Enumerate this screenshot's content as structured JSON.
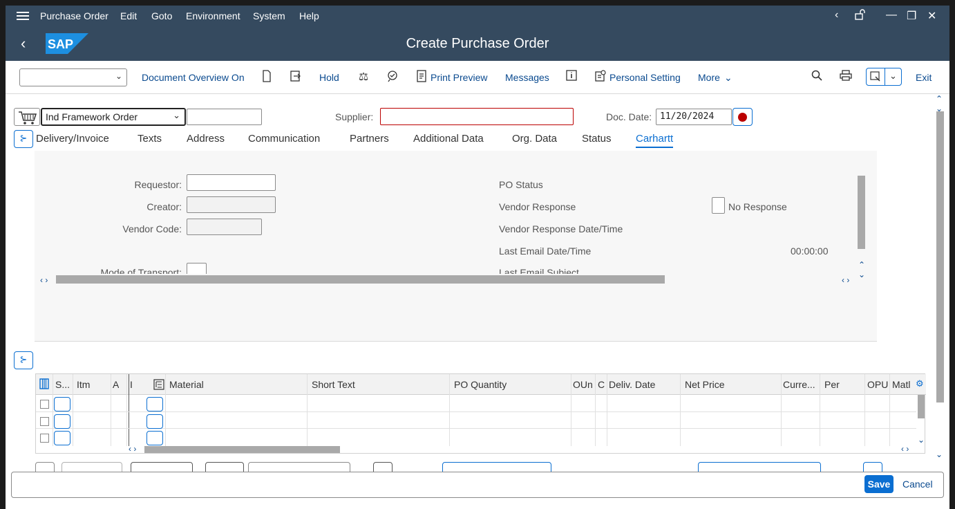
{
  "menu": {
    "items": [
      "Purchase Order",
      "Edit",
      "Goto",
      "Environment",
      "System",
      "Help"
    ]
  },
  "title": {
    "app_title": "Create Purchase Order",
    "logo_text": "SAP"
  },
  "toolbar": {
    "document_overview": "Document Overview On",
    "hold": "Hold",
    "print_preview": "Print Preview",
    "messages": "Messages",
    "personal_setting": "Personal Setting",
    "more": "More",
    "exit": "Exit"
  },
  "header": {
    "order_type": "Ind Framework Order",
    "supplier_label": "Supplier:",
    "supplier_value": "",
    "doc_date_label": "Doc. Date:",
    "doc_date_value": "11/20/2024"
  },
  "tabs": [
    "Delivery/Invoice",
    "Texts",
    "Address",
    "Communication",
    "Partners",
    "Additional Data",
    "Org. Data",
    "Status",
    "Carhartt"
  ],
  "active_tab": "Carhartt",
  "carhartt": {
    "requestor_label": "Requestor:",
    "creator_label": "Creator:",
    "vendor_code_label": "Vendor Code:",
    "mode_transport_label": "Mode of Transport:",
    "po_status_label": "PO Status",
    "vendor_response_label": "Vendor Response",
    "no_response_label": "No Response",
    "vendor_response_dt_label": "Vendor Response Date/Time",
    "last_email_dt_label": "Last Email Date/Time",
    "last_email_dt_value": "00:00:00",
    "last_email_subject_label": "Last Email Subject"
  },
  "grid": {
    "columns": [
      "S...",
      "Itm",
      "A",
      "I",
      "Material",
      "Short Text",
      "PO Quantity",
      "OUn",
      "C",
      "Deliv. Date",
      "Net Price",
      "Curre...",
      "Per",
      "OPU",
      "Matl"
    ],
    "rows": 3
  },
  "footer": {
    "save": "Save",
    "cancel": "Cancel"
  },
  "colors": {
    "shell": "#354a5f",
    "accent": "#0a6ed1",
    "record_red": "#bb0000"
  }
}
